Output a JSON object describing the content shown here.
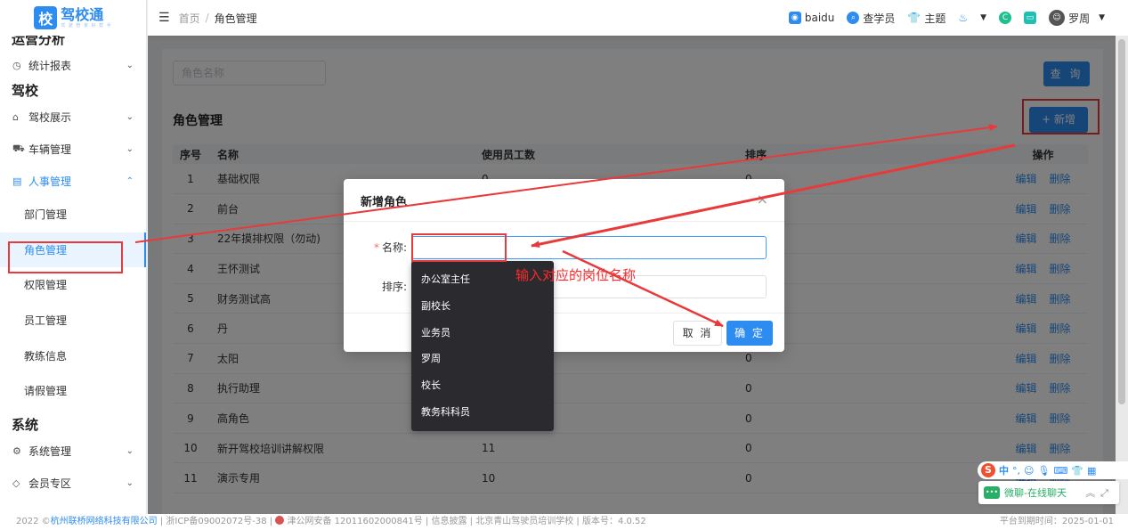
{
  "logo": {
    "badge": "校",
    "title": "驾校通",
    "slogan": "驾 驶 管 家 好 帮 手"
  },
  "sidebar": {
    "section_ops": "运营分析",
    "item_report": "统计报表",
    "section_school": "驾校",
    "item_display": "驾校展示",
    "item_vehicle": "车辆管理",
    "item_hr": "人事管理",
    "subs": [
      "部门管理",
      "角色管理",
      "权限管理",
      "员工管理",
      "教练信息",
      "请假管理"
    ],
    "section_system": "系统",
    "item_sysmgmt": "系统管理",
    "item_member": "会员专区"
  },
  "header": {
    "crumb_home": "首页",
    "crumb_sep": "/",
    "crumb_current": "角色管理",
    "link_baidu": "baidu",
    "link_student": "查学员",
    "link_theme": "主题",
    "user_name": "罗周"
  },
  "search": {
    "placeholder": "角色名称",
    "query_label": "查 询"
  },
  "main": {
    "title": "角色管理",
    "add_label": "+ 新增"
  },
  "table": {
    "columns": [
      "序号",
      "名称",
      "使用员工数",
      "排序",
      "操作"
    ],
    "edit_label": "编辑",
    "delete_label": "删除",
    "rows": [
      {
        "no": "1",
        "name": "基础权限",
        "count": "0",
        "sort": "0"
      },
      {
        "no": "2",
        "name": "前台",
        "count": "",
        "sort": ""
      },
      {
        "no": "3",
        "name": "22年摸排权限（勿动)",
        "count": "",
        "sort": ""
      },
      {
        "no": "4",
        "name": "王怀测试",
        "count": "",
        "sort": ""
      },
      {
        "no": "5",
        "name": "财务测试高",
        "count": "",
        "sort": ""
      },
      {
        "no": "6",
        "name": "丹",
        "count": "",
        "sort": ""
      },
      {
        "no": "7",
        "name": "太阳",
        "count": "",
        "sort": "0"
      },
      {
        "no": "8",
        "name": "执行助理",
        "count": "",
        "sort": "0"
      },
      {
        "no": "9",
        "name": "高角色",
        "count": "",
        "sort": "0"
      },
      {
        "no": "10",
        "name": "新开驾校培训讲解权限",
        "count": "11",
        "sort": "0"
      },
      {
        "no": "11",
        "name": "演示专用",
        "count": "10",
        "sort": "0"
      }
    ]
  },
  "modal": {
    "title": "新增角色",
    "close": "×",
    "name_label": "名称:",
    "required_mark": "*",
    "sort_label": "排序:",
    "cancel_label": "取 消",
    "ok_label": "确 定"
  },
  "dropdown": {
    "items": [
      "办公室主任",
      "副校长",
      "业务员",
      "罗周",
      "校长",
      "教务科科员"
    ]
  },
  "annotation": {
    "text": "输入对应的岗位名称",
    "color": "#ff2a2a"
  },
  "footer": {
    "year": "2022 ©",
    "company": "杭州联桥网络科技有限公司",
    "icp": "| 浙ICP备09002072号-38 |",
    "police": "津公网安备 12011602000841号",
    "info": "| 信息披露 | 北京青山驾驶员培训学校 | 版本号：4.0.52",
    "expiry": "平台到期时间：2025-01-01"
  },
  "ime": {
    "zh": "中"
  },
  "chat": {
    "label": "微聊-在线聊天"
  },
  "colors": {
    "primary": "#2d8cf0",
    "annotation": "#e83a3a"
  }
}
